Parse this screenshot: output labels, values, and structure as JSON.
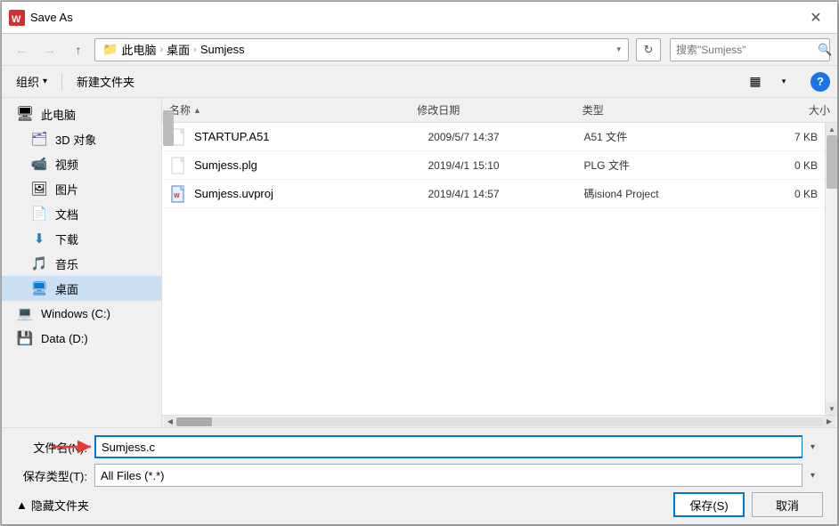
{
  "titlebar": {
    "title": "Save As",
    "close_label": "✕",
    "icon": "W"
  },
  "navbar": {
    "back_label": "←",
    "forward_label": "→",
    "up_label": "↑",
    "breadcrumbs": [
      "此电脑",
      "桌面",
      "Sumjess"
    ],
    "refresh_label": "↻",
    "search_placeholder": "搜索\"Sumjess\"",
    "search_icon": "🔍"
  },
  "toolbar": {
    "organize_label": "组织",
    "organize_arrow": "▾",
    "new_folder_label": "新建文件夹",
    "view_icon": "▦",
    "view_arrow": "▾",
    "help_icon": "?"
  },
  "file_list": {
    "columns": {
      "name": "名称",
      "sort_arrow": "▲",
      "date": "修改日期",
      "type": "类型",
      "size": "大小"
    },
    "files": [
      {
        "name": "STARTUP.A51",
        "date": "2009/5/7 14:37",
        "type": "A51 文件",
        "size": "7 KB",
        "icon_type": "generic"
      },
      {
        "name": "Sumjess.plg",
        "date": "2019/4/1 15:10",
        "type": "PLG 文件",
        "size": "0 KB",
        "icon_type": "generic"
      },
      {
        "name": "Sumjess.uvproj",
        "date": "2019/4/1 14:57",
        "type": "碼ision4 Project",
        "size": "0 KB",
        "icon_type": "uvproj"
      }
    ]
  },
  "sidebar": {
    "items": [
      {
        "label": "此电脑",
        "icon": "computer",
        "active": false
      },
      {
        "label": "3D 对象",
        "icon": "3d",
        "active": false
      },
      {
        "label": "视频",
        "icon": "video",
        "active": false
      },
      {
        "label": "图片",
        "icon": "picture",
        "active": false
      },
      {
        "label": "文档",
        "icon": "doc",
        "active": false
      },
      {
        "label": "下载",
        "icon": "download",
        "active": false
      },
      {
        "label": "音乐",
        "icon": "music",
        "active": false
      },
      {
        "label": "桌面",
        "icon": "desktop",
        "active": true
      },
      {
        "label": "Windows (C:)",
        "icon": "windows",
        "active": false
      },
      {
        "label": "Data (D:)",
        "icon": "drive",
        "active": false
      }
    ]
  },
  "form": {
    "filename_label": "文件名(N):",
    "filename_value": "Sumjess.c",
    "filetype_label": "保存类型(T):",
    "filetype_value": "All Files (*.*)"
  },
  "actions": {
    "hide_folder_label": "隐藏文件夹",
    "hide_arrow": "▲",
    "save_label": "保存(S)",
    "cancel_label": "取消"
  },
  "colors": {
    "accent": "#0078d7",
    "active_bg": "#cce0f5",
    "hover_bg": "#d8e4f0"
  }
}
